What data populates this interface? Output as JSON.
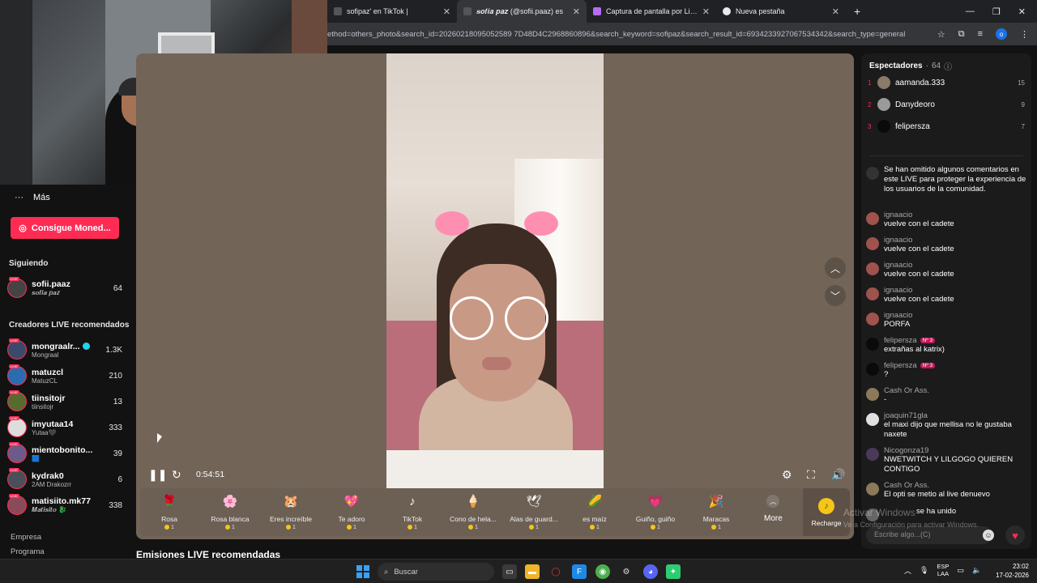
{
  "browser": {
    "tabs": [
      {
        "title": "sofipaz' en TikTok | ",
        "active": false
      },
      {
        "title": "𝒔𝒐𝒇𝒊𝒂 𝒑𝒂𝒛 (@sofii.paaz) es",
        "active": true
      },
      {
        "title": "Captura de pantalla por Lightsh",
        "active": false
      },
      {
        "title": "Nueva pestaña",
        "active": false
      }
    ],
    "url": "ethod=others_photo&search_id=20260218095052589 7D48D4C2968860896&search_keyword=sofipaz&search_result_id=6934233927067534342&search_type=general"
  },
  "sidebar": {
    "more_label": "Más",
    "coins_button": "Consigue Moned...",
    "following_title": "Siguiendo",
    "following": [
      {
        "name": "sofii.paaz",
        "sub": "𝒔𝒐𝒇𝒊𝒂 𝒑𝒂𝒛",
        "count": "64"
      }
    ],
    "recommended_title": "Creadores LIVE recomendados",
    "recommended": [
      {
        "name": "mongraalr...",
        "sub": "Mongraal",
        "count": "1.3K"
      },
      {
        "name": "matuzcl",
        "sub": "MatuzCL",
        "count": "210"
      },
      {
        "name": "tiinsitojr",
        "sub": "tiinsitojr",
        "count": "13"
      },
      {
        "name": "imyutaa14",
        "sub": "Yutaa🖤",
        "count": "333"
      },
      {
        "name": "mientobonito...",
        "sub": "🟦",
        "count": "39"
      },
      {
        "name": "kydrak0",
        "sub": "2AM Drakozrr",
        "count": "6"
      },
      {
        "name": "matisiito.mk77",
        "sub": "𝑴𝒂𝒕𝒊𝒔𝒊𝒕𝒐 🐉",
        "count": "338"
      }
    ],
    "footer": [
      "Empresa",
      "Programa"
    ]
  },
  "player": {
    "elapsed": "0:54:51",
    "recommended_heading": "Emisiones LIVE recomendadas"
  },
  "gifts": {
    "items": [
      {
        "name": "Rosa",
        "price": "1",
        "icon": "🌹"
      },
      {
        "name": "Rosa blanca",
        "price": "1",
        "icon": "🌸"
      },
      {
        "name": "Eres increíble",
        "price": "1",
        "icon": "🐹"
      },
      {
        "name": "Te adoro",
        "price": "1",
        "icon": "💖"
      },
      {
        "name": "TikTok",
        "price": "1",
        "icon": "♪"
      },
      {
        "name": "Cono de hela...",
        "price": "1",
        "icon": "🍦"
      },
      {
        "name": "Alas de guard...",
        "price": "1",
        "icon": "🪽"
      },
      {
        "name": "es maíz",
        "price": "1",
        "icon": "🌽"
      },
      {
        "name": "Guiño, guiño",
        "price": "1",
        "icon": "💗"
      },
      {
        "name": "Maracas",
        "price": "1",
        "icon": "🪇"
      }
    ],
    "more_label": "More",
    "recharge_label": "Recharge"
  },
  "viewers": {
    "title": "Espectadores",
    "count": "64",
    "list": [
      {
        "rank": "1",
        "name": "aamanda.333",
        "score": "15"
      },
      {
        "rank": "2",
        "name": "Danydeoro",
        "score": "9"
      },
      {
        "rank": "3",
        "name": "felipersza",
        "score": "7"
      }
    ]
  },
  "chat": {
    "system_message": "Se han omitido algunos comentarios en este LIVE para proteger la experiencia de los usuarios de la comunidad.",
    "messages": [
      {
        "user": "ignaacio",
        "badge": "",
        "text": "vuelve con el cadete"
      },
      {
        "user": "ignaacio",
        "badge": "",
        "text": "vuelve con el cadete"
      },
      {
        "user": "ignaacio",
        "badge": "",
        "text": "vuelve con el cadete"
      },
      {
        "user": "ignaacio",
        "badge": "",
        "text": "vuelve con el cadete"
      },
      {
        "user": "ignaacio",
        "badge": "",
        "text": "PORFA"
      },
      {
        "user": "felipersza",
        "badge": "Nº 3",
        "text": "extrañas al katrix)"
      },
      {
        "user": "felipersza",
        "badge": "Nº 3",
        "text": "?"
      },
      {
        "user": "Cash Or Ass.",
        "badge": "",
        "text": "-"
      },
      {
        "user": "joaquin71gla",
        "badge": "",
        "text": "el maxi dijo que mellisa no le gustaba naxete"
      },
      {
        "user": "Nicogonza19",
        "badge": "",
        "text": "NWETWITCH Y LILGOGO QUIEREN CONTIGO"
      },
      {
        "user": "Cash Or Ass.",
        "badge": "",
        "text": "El opti se metio al live denuevo"
      }
    ],
    "joined_text": "se ha unido",
    "input_placeholder": "Escribe algo...(C)"
  },
  "overlay": {
    "watermark_title": "Activar Windows",
    "watermark_sub": "Ve a Configuración para activar Windows."
  },
  "taskbar": {
    "search_placeholder": "Buscar",
    "lang_line1": "ESP",
    "lang_line2": "LAA",
    "time": "23:02",
    "date": "17-02-2026"
  },
  "colors": {
    "accent": "#fe2c55",
    "player_bg": "#726457",
    "panel_bg": "#1b1b1b"
  }
}
